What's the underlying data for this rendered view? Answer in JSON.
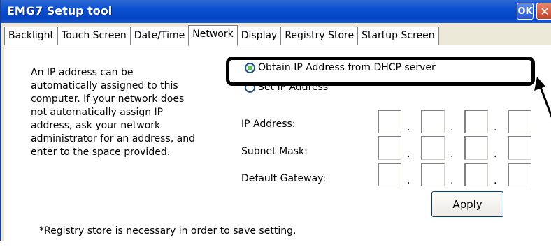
{
  "window": {
    "title": "EMG7 Setup tool",
    "ok_label": "OK",
    "close_label": "✕"
  },
  "tabs": [
    {
      "label": "Backlight",
      "active": false
    },
    {
      "label": "Touch Screen",
      "active": false
    },
    {
      "label": "Date/Time",
      "active": false
    },
    {
      "label": "Network",
      "active": true
    },
    {
      "label": "Display",
      "active": false
    },
    {
      "label": "Registry Store",
      "active": false
    },
    {
      "label": "Startup Screen",
      "active": false
    }
  ],
  "network": {
    "description": "An IP address can be automatically assigned to this computer. If your network does not automatically assign IP address, ask your network administrator for an address, and enter to the space provided.",
    "description_lines": [
      "An IP address can be",
      "automatically assigned to this",
      "computer. If your network does",
      "not automatically assign IP",
      "address, ask your network",
      "administrator for an address, and",
      "enter to the space provided."
    ],
    "radio_dhcp_label": "Obtain IP Address from DHCP server",
    "radio_set_label": "Set IP Address",
    "radio_selected": "dhcp",
    "ip_address_label": "IP Address:",
    "subnet_mask_label": "Subnet Mask:",
    "default_gateway_label": "Default Gateway:",
    "ip_address_octets": [
      "",
      "",
      "",
      ""
    ],
    "subnet_mask_octets": [
      "",
      "",
      "",
      ""
    ],
    "default_gateway_octets": [
      "",
      "",
      "",
      ""
    ],
    "octet_separator": ".",
    "apply_label": "Apply",
    "footnote": "*Registry store is necessary in order to save setting."
  },
  "colors": {
    "titlebar": "#0a4fd0",
    "panel": "#ffffff",
    "highlight": "#000000",
    "radio_selected": "#1fa01f"
  }
}
